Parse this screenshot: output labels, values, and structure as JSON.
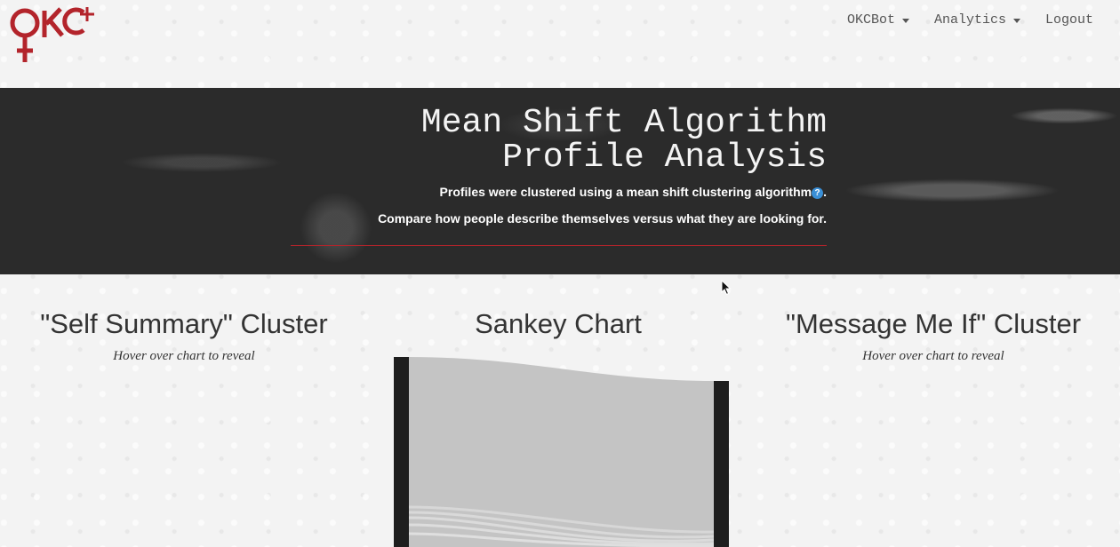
{
  "logo": {
    "text": "OK+",
    "color": "#b3242b"
  },
  "nav": {
    "items": [
      {
        "label": "OKCBot",
        "dropdown": true
      },
      {
        "label": "Analytics",
        "dropdown": true
      },
      {
        "label": "Logout",
        "dropdown": false
      }
    ]
  },
  "hero": {
    "title_line1": "Mean Shift Algorithm",
    "title_line2": "Profile Analysis",
    "line1_text": "Profiles were clustered using a mean shift clustering algorithm",
    "help_icon": "?",
    "line1_end": ".",
    "line2_text": "Compare how people describe themselves versus what they are looking for.",
    "rule_color": "#b3242b"
  },
  "columns": {
    "left": {
      "title": "\"Self Summary\" Cluster",
      "subtitle": "Hover over chart to reveal"
    },
    "center": {
      "title": "Sankey Chart"
    },
    "right": {
      "title": "\"Message Me If\" Cluster",
      "subtitle": "Hover over chart to reveal"
    }
  }
}
